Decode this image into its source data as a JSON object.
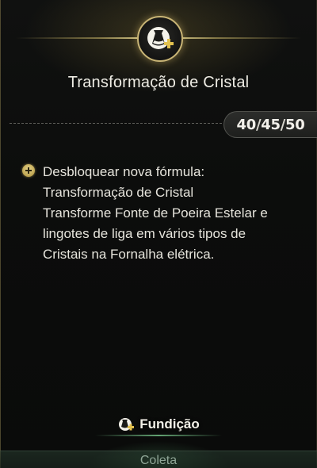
{
  "header": {
    "icon": "alchemy-flask-icon",
    "title": "Transformação de Cristal"
  },
  "level": {
    "current": "40",
    "mid": "45",
    "max": "50",
    "separator": "/"
  },
  "feature": {
    "icon": "plus-circle-icon",
    "lines": [
      "Desbloquear nova fórmula:",
      "Transformação de Cristal",
      "Transforme Fonte de Poeira Estelar e",
      "lingotes de liga em vários tipos de",
      "Cristais na Fornalha elétrica."
    ]
  },
  "category": {
    "icon": "smelting-icon",
    "label": "Fundição"
  },
  "bottom_bar": {
    "label": "Coleta"
  },
  "colors": {
    "accent_gold": "#c9b576",
    "bottom_glow_green": "#5aaa6e"
  }
}
